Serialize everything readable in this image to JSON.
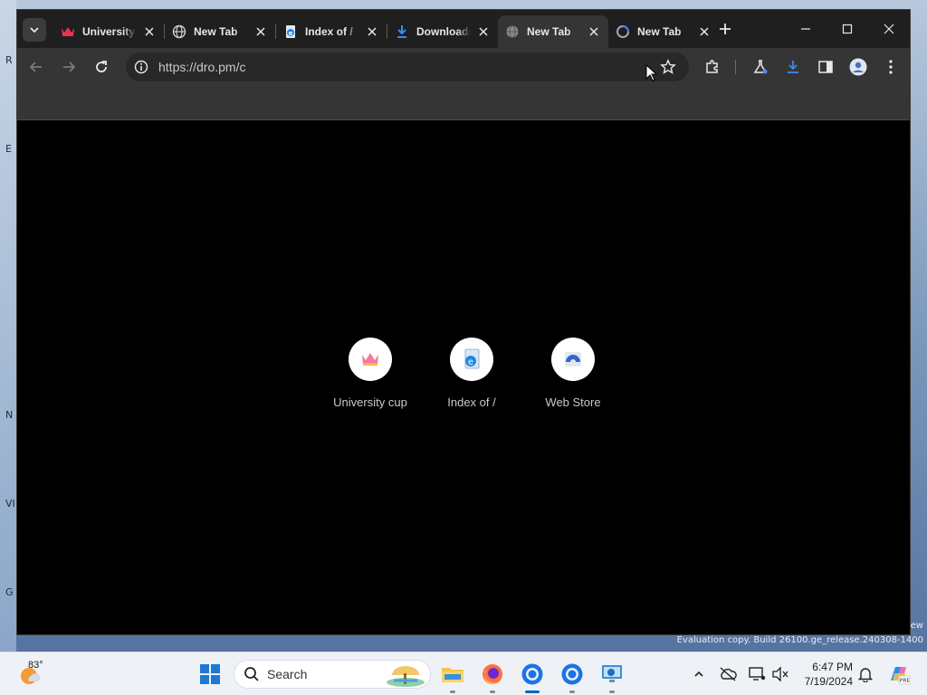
{
  "browser": {
    "tabs": [
      {
        "title": "University cup",
        "favicon": "crown-icon",
        "active": false
      },
      {
        "title": "New Tab",
        "favicon": "globe-icon",
        "active": false
      },
      {
        "title": "Index of /",
        "favicon": "ie-document-icon",
        "active": false
      },
      {
        "title": "Downloads",
        "favicon": "download-icon",
        "active": false
      },
      {
        "title": "New Tab",
        "favicon": "globe-icon",
        "active": true
      },
      {
        "title": "New Tab",
        "favicon": "loading-icon",
        "active": false
      }
    ],
    "url": "https://dro.pm/c"
  },
  "new_tab_page": {
    "shortcuts": [
      {
        "label": "University cup",
        "icon": "crown-icon"
      },
      {
        "label": "Index of /",
        "icon": "ie-document-icon"
      },
      {
        "label": "Web Store",
        "icon": "webstore-icon"
      }
    ]
  },
  "taskbar": {
    "weather_temp": "83°",
    "search_placeholder": "Search",
    "time": "6:47 PM",
    "date": "7/19/2024"
  },
  "desktop": {
    "watermark_line1": "Evaluation copy. Build 26100.ge_release.240308-1400",
    "watermark_line2": "ew"
  },
  "colors": {
    "tabstrip": "#1f1f1f",
    "toolbar": "#353535",
    "accent_blue": "#0067c0"
  }
}
